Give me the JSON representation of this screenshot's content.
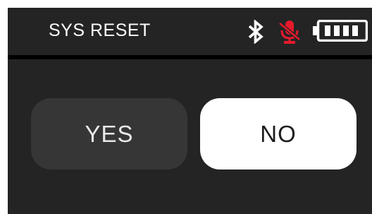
{
  "header": {
    "title": "SYS RESET",
    "icons": [
      "bluetooth-icon",
      "microphone-muted-icon",
      "battery-full-icon"
    ]
  },
  "dialog": {
    "yes_label": "YES",
    "no_label": "NO",
    "selected": "NO"
  },
  "colors": {
    "background": "#242424",
    "divider": "#000000",
    "text": "#ffffff",
    "mute_accent": "#e8192c",
    "unselected_button": "#363636",
    "selected_button": "#ffffff"
  }
}
